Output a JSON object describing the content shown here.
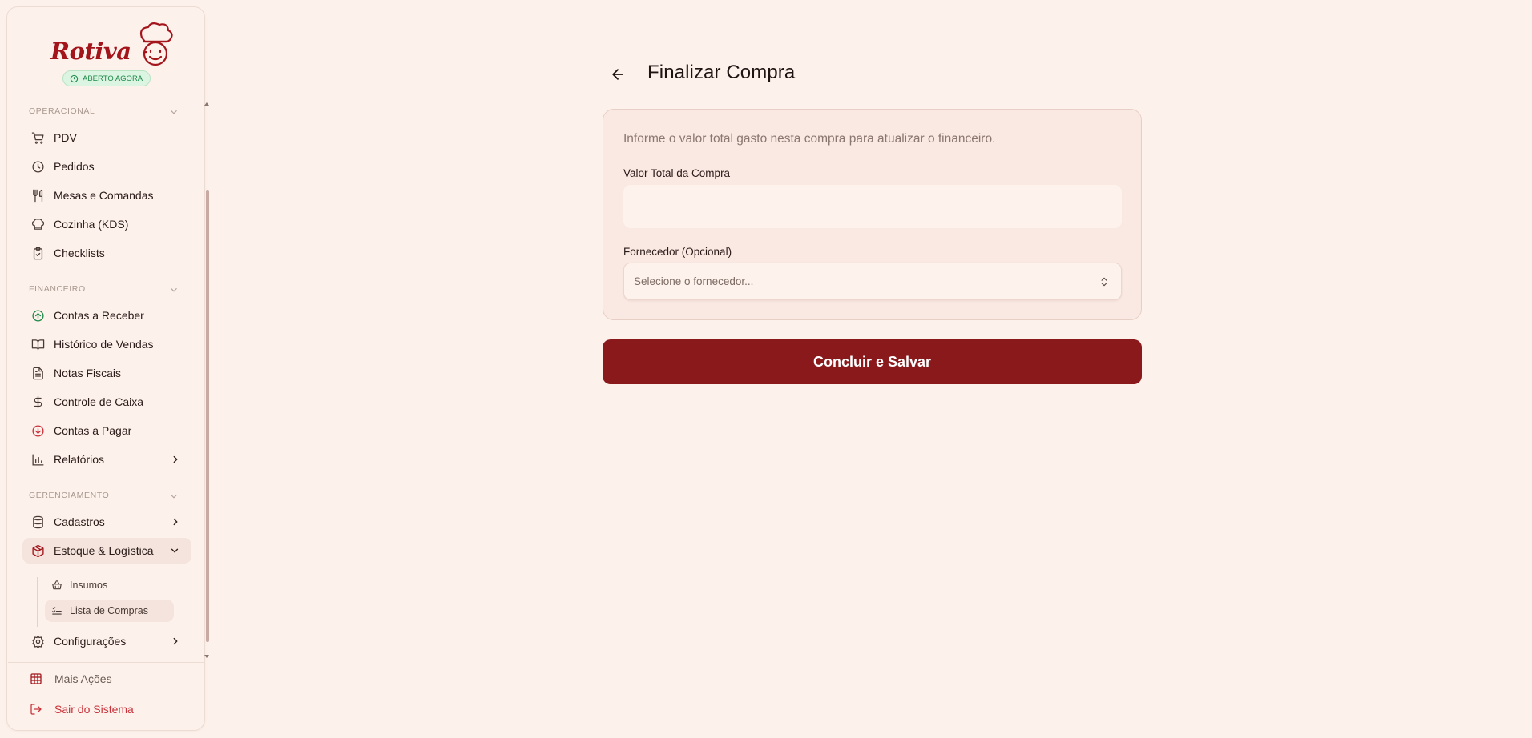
{
  "brand": {
    "name": "Rotiva",
    "status": "ABERTO AGORA"
  },
  "sidebar": {
    "sections": [
      {
        "title": "OPERACIONAL"
      },
      {
        "title": "FINANCEIRO"
      },
      {
        "title": "GERENCIAMENTO"
      }
    ],
    "operacional": [
      {
        "label": "PDV",
        "icon": "cart-icon"
      },
      {
        "label": "Pedidos",
        "icon": "clock-icon"
      },
      {
        "label": "Mesas e Comandas",
        "icon": "utensils-icon"
      },
      {
        "label": "Cozinha (KDS)",
        "icon": "chef-hat-icon"
      },
      {
        "label": "Checklists",
        "icon": "clipboard-check-icon"
      }
    ],
    "financeiro": [
      {
        "label": "Contas a Receber",
        "icon": "arrow-up-circle-icon"
      },
      {
        "label": "Histórico de Vendas",
        "icon": "book-icon"
      },
      {
        "label": "Notas Fiscais",
        "icon": "file-text-icon"
      },
      {
        "label": "Controle de Caixa",
        "icon": "dollar-icon"
      },
      {
        "label": "Contas a Pagar",
        "icon": "arrow-down-circle-icon"
      },
      {
        "label": "Relatórios",
        "icon": "bar-chart-icon"
      }
    ],
    "gerenciamento": [
      {
        "label": "Cadastros",
        "icon": "database-icon"
      },
      {
        "label": "Estoque & Logística",
        "icon": "package-icon"
      },
      {
        "label": "Configurações",
        "icon": "gear-icon"
      }
    ],
    "estoque_sub": [
      {
        "label": "Insumos",
        "icon": "basket-icon"
      },
      {
        "label": "Lista de Compras",
        "icon": "list-checks-icon"
      }
    ],
    "bottom": [
      {
        "label": "Mais Ações",
        "icon": "grid-icon"
      },
      {
        "label": "Sair do Sistema",
        "icon": "logout-icon"
      }
    ]
  },
  "main": {
    "title": "Finalizar Compra",
    "description": "Informe o valor total gasto nesta compra para atualizar o financeiro.",
    "total_label": "Valor Total da Compra",
    "total_value": "",
    "supplier_label": "Fornecedor (Opcional)",
    "supplier_placeholder": "Selecione o fornecedor...",
    "submit_label": "Concluir e Salvar"
  },
  "colors": {
    "background": "#fdf1eb",
    "brand": "#a3141b",
    "primary_button": "#8a191c",
    "success": "#1f8a4a",
    "danger": "#c8323a"
  }
}
